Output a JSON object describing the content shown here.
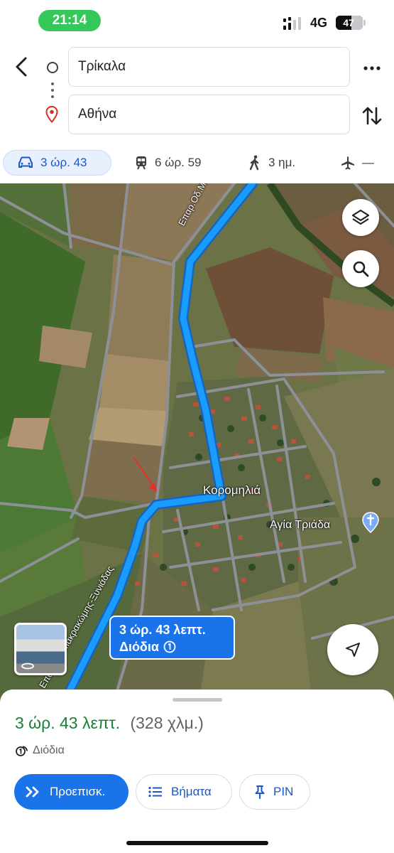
{
  "status_bar": {
    "time": "21:14",
    "network": "4G",
    "battery": "47",
    "colors": {
      "time_pill": "#34c759"
    }
  },
  "route": {
    "origin": "Τρίκαλα",
    "destination": "Αθήνα",
    "icons": [
      "back-arrow-icon",
      "origin-circle-icon",
      "destination-pin-icon",
      "more-vert-icon",
      "swap-icon"
    ]
  },
  "modes": [
    {
      "id": "drive",
      "icon": "car-icon",
      "label": "3 ώρ. 43",
      "selected": true
    },
    {
      "id": "transit",
      "icon": "train-icon",
      "label": "6 ώρ. 59"
    },
    {
      "id": "walk",
      "icon": "walk-icon",
      "label": "3 ημ."
    },
    {
      "id": "flight",
      "icon": "airplane-icon",
      "label": "—"
    }
  ],
  "map": {
    "village": "Κορομηλιά",
    "church": "Αγία Τριάδα",
    "road_top": "Επαρ.Οδ.Μακρακώ",
    "road_bottom": "Επαρ.Οδ. Μακρακώμης-Ξυνιάδας",
    "callout": {
      "duration": "3 ώρ. 43 λεπτ.",
      "toll": "Διόδια"
    },
    "colors": {
      "route": "#1a9cff",
      "route_outline": "#1565c0"
    }
  },
  "sheet": {
    "duration": "3 ώρ. 43 λεπτ.",
    "distance": "(328 χλμ.)",
    "toll": "Διόδια",
    "actions": {
      "preview": "Προεπισκ.",
      "steps": "Βήματα",
      "pin": "PIN"
    },
    "colors": {
      "duration": "#188038",
      "primary": "#1a73e8"
    }
  }
}
